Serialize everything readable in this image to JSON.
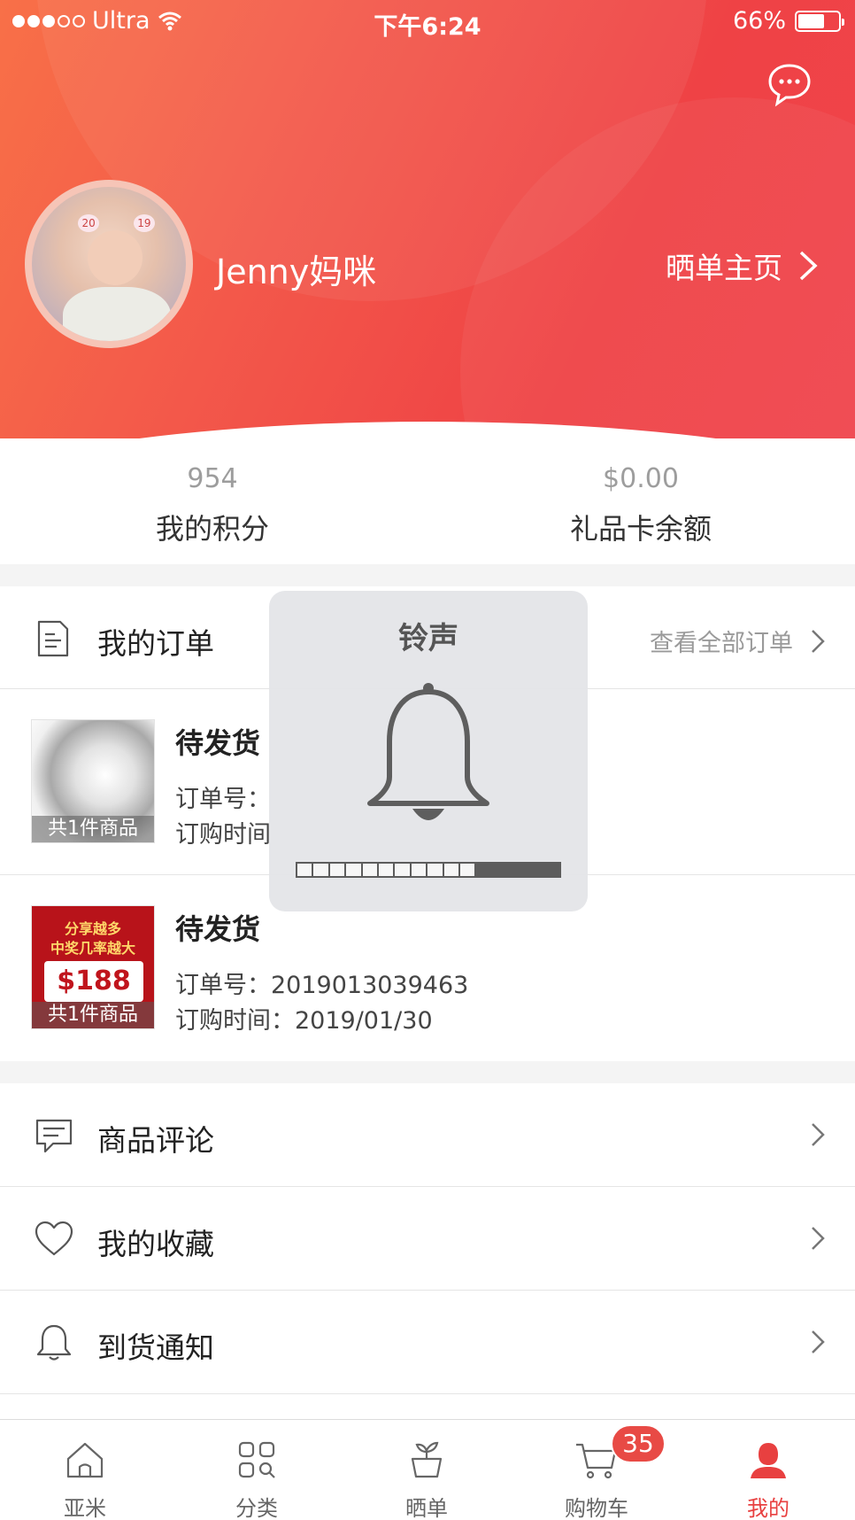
{
  "status_bar": {
    "carrier": "Ultra",
    "time": "下午6:24",
    "battery_text": "66%",
    "battery_level": 0.66
  },
  "profile": {
    "username": "Jenny妈咪",
    "home_link": "晒单主页",
    "avatar_badge_left": "20",
    "avatar_badge_right": "19"
  },
  "stats": [
    {
      "value": "954",
      "label": "我的积分"
    },
    {
      "value": "$0.00",
      "label": "礼品卡余额"
    }
  ],
  "orders_section": {
    "title": "我的订单",
    "view_all": "查看全部订单",
    "orders": [
      {
        "status": "待发货",
        "order_no": "订单号：",
        "order_time": "订购时间",
        "item_count": "共1件商品"
      },
      {
        "status": "待发货",
        "order_no": "订单号：2019013039463",
        "order_time": "订购时间：2019/01/30",
        "item_count": "共1件商品",
        "thumb_line1": "分享越多",
        "thumb_line2": "中奖几率越大",
        "thumb_price": "$188"
      }
    ]
  },
  "menu": [
    {
      "label": "商品评论",
      "icon": "comment-icon"
    },
    {
      "label": "我的收藏",
      "icon": "heart-icon"
    },
    {
      "label": "到货通知",
      "icon": "bell-icon"
    }
  ],
  "tabbar": {
    "tabs": [
      {
        "label": "亚米",
        "icon": "home-icon"
      },
      {
        "label": "分类",
        "icon": "category-icon"
      },
      {
        "label": "晒单",
        "icon": "plant-icon"
      },
      {
        "label": "购物车",
        "icon": "cart-icon"
      },
      {
        "label": "我的",
        "icon": "user-icon"
      }
    ],
    "active_tab": "我的",
    "cart_badge": "35"
  },
  "ringer_hud": {
    "title": "铃声",
    "volume_level": 0.69
  },
  "colors": {
    "brand_red": "#ef4245",
    "active_tab": "#e84040",
    "badge": "#e84a45"
  }
}
